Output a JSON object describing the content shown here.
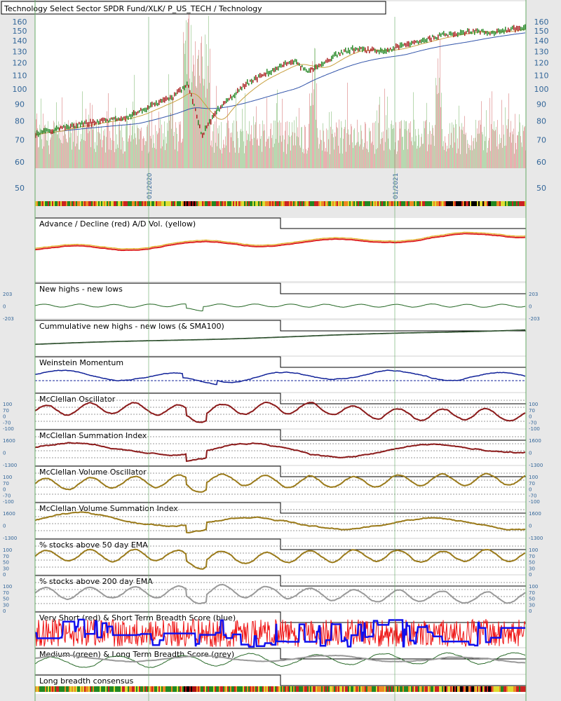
{
  "chart_data": {
    "type": "line",
    "title": "Technology Select Sector SPDR Fund/XLK/ P_US_TECH / Technology",
    "x_dates": [
      "01/2020",
      "01/2021"
    ],
    "price_axis": {
      "scale": "log",
      "range": [
        55,
        165
      ],
      "ticks": [
        "160",
        "150",
        "140",
        "130",
        "120",
        "110",
        "100",
        "90",
        "80",
        "70",
        "60",
        "50"
      ]
    },
    "price_series": {
      "approx_points": [
        [
          "2019-04",
          73
        ],
        [
          "2019-07",
          78
        ],
        [
          "2019-10",
          82
        ],
        [
          "2020-01",
          94
        ],
        [
          "2020-02",
          103
        ],
        [
          "2020-03",
          72
        ],
        [
          "2020-04",
          86
        ],
        [
          "2020-06",
          104
        ],
        [
          "2020-09",
          122
        ],
        [
          "2020-10",
          112
        ],
        [
          "2020-12",
          128
        ],
        [
          "2021-01",
          132
        ],
        [
          "2021-03",
          130
        ],
        [
          "2021-05",
          138
        ],
        [
          "2021-07",
          146
        ],
        [
          "2021-09",
          150
        ],
        [
          "2021-10",
          148
        ],
        [
          "2021-12",
          153
        ]
      ],
      "moving_averages": [
        "gold",
        "blue"
      ]
    },
    "panels": [
      {
        "title": "Advance / Decline (red) A/D Vol. (yellow)",
        "ticks": []
      },
      {
        "title": "New highs - new lows",
        "ticks": [
          "203",
          "0",
          "-203"
        ]
      },
      {
        "title": "Cummulative new highs - new lows (& SMA100)",
        "ticks": []
      },
      {
        "title": "Weinstein Momentum",
        "ticks": []
      },
      {
        "title": "McClellan Oscillator",
        "ticks": [
          "100",
          "70",
          "0",
          "-70",
          "-100"
        ]
      },
      {
        "title": "McClellan Summation Index",
        "ticks": [
          "1600",
          "0",
          "-1300"
        ]
      },
      {
        "title": "McClellan Volume Oscillator",
        "ticks": [
          "100",
          "70",
          "0",
          "-70",
          "-100"
        ]
      },
      {
        "title": "McClellan Volume Summation Index",
        "ticks": [
          "1600",
          "0",
          "-1300"
        ]
      },
      {
        "title": "% stocks above 50 day EMA",
        "ticks": [
          "100",
          "70",
          "50",
          "30",
          "0"
        ]
      },
      {
        "title": "% stocks above 200 day EMA",
        "ticks": [
          "100",
          "70",
          "50",
          "30",
          "0"
        ]
      },
      {
        "title": "Very Short (red) & Short Term Breadth Score (blue)",
        "ticks": []
      },
      {
        "title": "Medium (green) & Long Term Breadth Score (grey)",
        "ticks": []
      },
      {
        "title": "Long breadth consensus",
        "ticks": []
      }
    ],
    "colors": {
      "background": "#e8e8e8",
      "plot_bg": "#ffffff",
      "axis_text": "#336699",
      "ad_line": "#dd2222",
      "ad_vol": "#e0b020",
      "nhnl": "#226622",
      "weinstein": "#112299",
      "mcclellan": "#8b1a1a",
      "volume_osc": "#9a7a1a",
      "pct200": "#999999",
      "short_red": "#ee1111",
      "short_blue": "#1111ee",
      "medium_green": "#2a6a2a",
      "long_grey": "#999999",
      "ma_gold": "#c8a040",
      "ma_blue": "#3355aa",
      "vgrid": "#66aa66"
    }
  }
}
